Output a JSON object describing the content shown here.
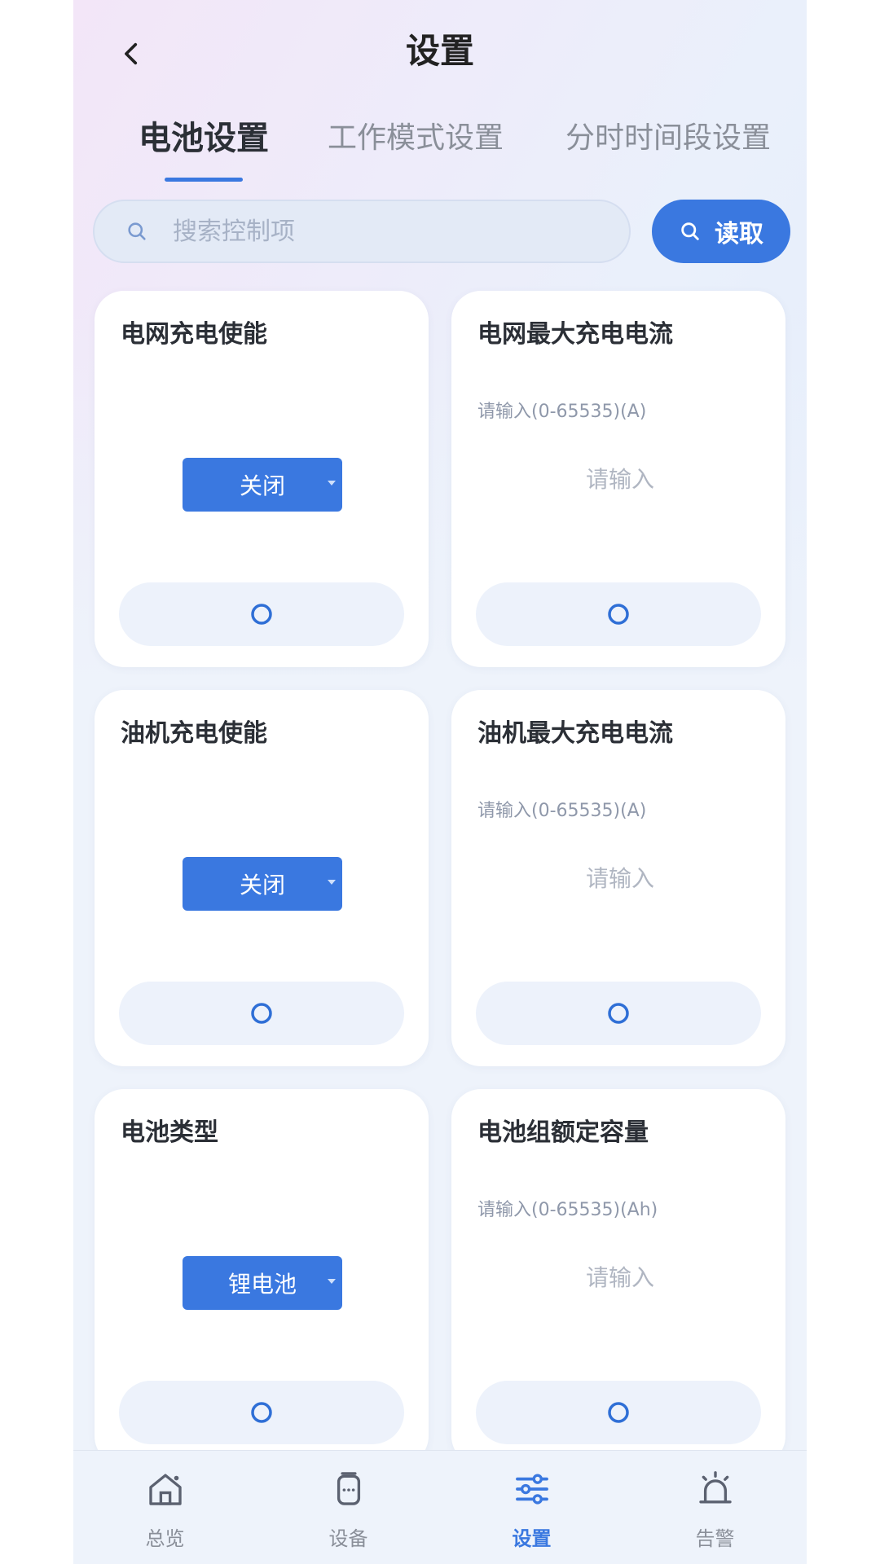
{
  "header": {
    "title": "设置"
  },
  "tabs": [
    {
      "label": "电池设置",
      "active": true
    },
    {
      "label": "工作模式设置",
      "active": false
    },
    {
      "label": "分时时间段设置",
      "active": false
    }
  ],
  "search": {
    "placeholder": "搜索控制项",
    "value": "",
    "button_label": "读取"
  },
  "cards": [
    {
      "title": "电网充电使能",
      "type": "select",
      "selected": "关闭"
    },
    {
      "title": "电网最大充电电流",
      "type": "input",
      "hint": "请输入(0-65535)(A)",
      "placeholder": "请输入"
    },
    {
      "title": "油机充电使能",
      "type": "select",
      "selected": "关闭"
    },
    {
      "title": "油机最大充电电流",
      "type": "input",
      "hint": "请输入(0-65535)(A)",
      "placeholder": "请输入"
    },
    {
      "title": "电池类型",
      "type": "select",
      "selected": "锂电池"
    },
    {
      "title": "电池组额定容量",
      "type": "input",
      "hint": "请输入(0-65535)(Ah)",
      "placeholder": "请输入"
    }
  ],
  "nav": [
    {
      "label": "总览",
      "icon": "home-icon",
      "active": false
    },
    {
      "label": "设备",
      "icon": "device-icon",
      "active": false
    },
    {
      "label": "设置",
      "icon": "settings-sliders-icon",
      "active": true
    },
    {
      "label": "告警",
      "icon": "alarm-icon",
      "active": false
    }
  ],
  "colors": {
    "accent": "#3a78e0",
    "card_bg": "#ffffff",
    "action_bg": "#edf2fb",
    "nav_bg": "#eef3fb"
  }
}
